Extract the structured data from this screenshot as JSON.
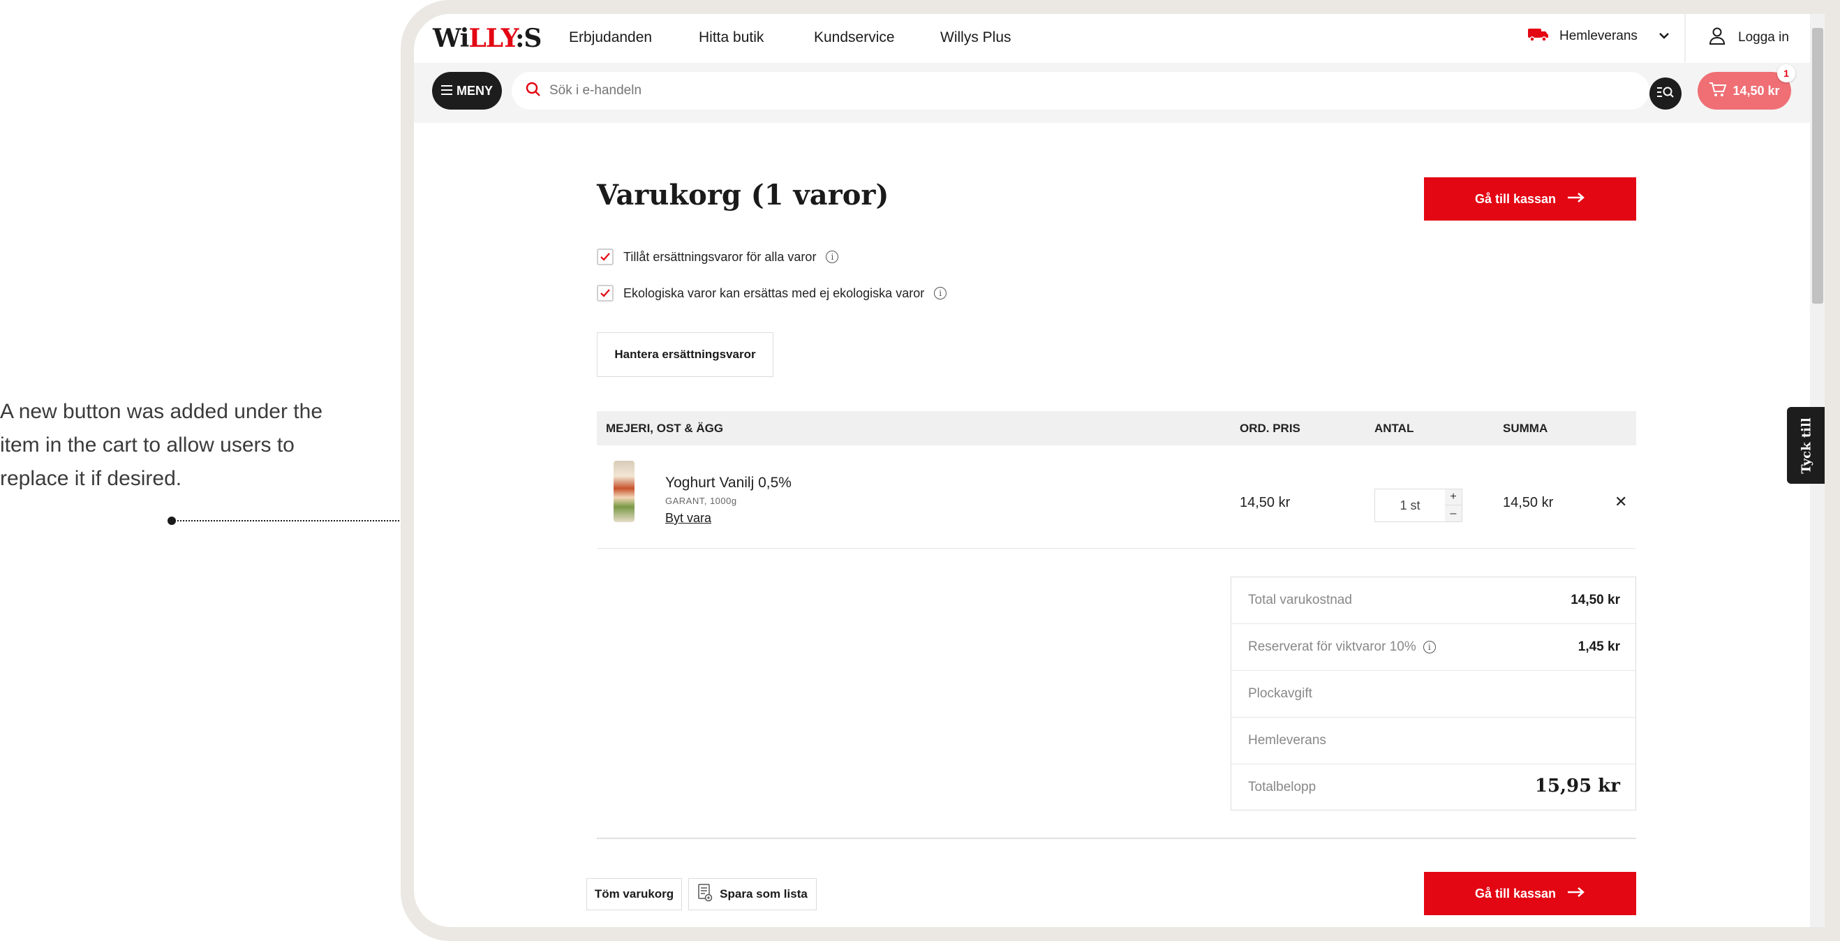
{
  "annotation": {
    "text": "A new button was added under the item in the cart to allow users to replace it if desired."
  },
  "header": {
    "logo": {
      "part1": "Wi",
      "part2": "LLY",
      "part3": ":S"
    },
    "nav": [
      "Erbjudanden",
      "Hitta butik",
      "Kundservice",
      "Willys Plus"
    ],
    "delivery_label": "Hemleverans",
    "login_label": "Logga in"
  },
  "searchbar": {
    "menu_label": "MENY",
    "placeholder": "Sök i e-handeln",
    "cart_total": "14,50 kr",
    "cart_count": "1"
  },
  "cart": {
    "title": "Varukorg (1 varor)",
    "checkout_label": "Gå till kassan",
    "options": [
      {
        "label": "Tillåt ersättningsvaror för alla varor",
        "checked": true
      },
      {
        "label": "Ekologiska varor kan ersättas med ej ekologiska varor",
        "checked": true
      }
    ],
    "manage_button": "Hantera ersättningsvaror",
    "table": {
      "category": "MEJERI, OST & ÄGG",
      "col_price": "ORD. PRIS",
      "col_qty": "ANTAL",
      "col_sum": "SUMMA"
    },
    "items": [
      {
        "name": "Yoghurt Vanilj 0,5%",
        "sub": "GARANT, 1000g",
        "swap_link": "Byt vara",
        "price": "14,50 kr",
        "qty": "1 st",
        "sum": "14,50 kr"
      }
    ],
    "summary": [
      {
        "label": "Total varukostnad",
        "value": "14,50 kr"
      },
      {
        "label": "Reserverat för viktvaror 10%",
        "value": "1,45 kr"
      },
      {
        "label": "Plockavgift",
        "value": ""
      },
      {
        "label": "Hemleverans",
        "value": ""
      },
      {
        "label": "Totalbelopp",
        "value": "15,95 kr"
      }
    ],
    "clear_button": "Töm varukorg",
    "save_list_button": "Spara som lista"
  },
  "feedback_tab": "Tyck till",
  "colors": {
    "brand_red": "#e30613",
    "cart_pink": "#ef6f75",
    "dark": "#1d1d1d"
  }
}
